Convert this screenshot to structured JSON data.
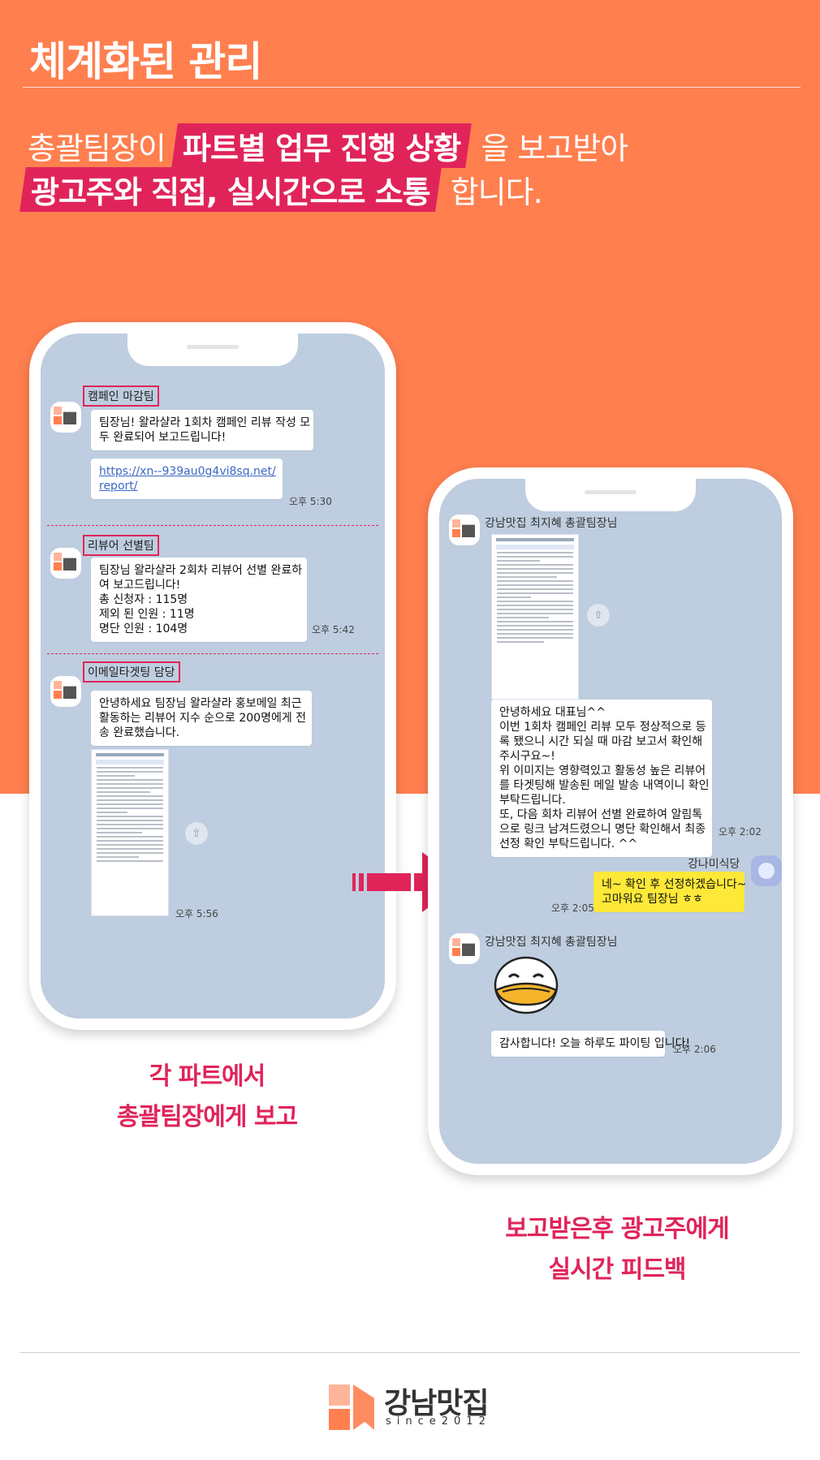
{
  "header": {
    "title": "체계화된 관리",
    "line1_pre": "총괄팀장이",
    "line1_highlight": "파트별 업무 진행 상황",
    "line1_post": "을 보고받아",
    "line2_highlight": "광고주와 직접, 실시간으로 소통",
    "line2_post": "합니다."
  },
  "phone_left": {
    "chat1": {
      "team": "캠페인 마감팀",
      "message": [
        "팀장님! 왈라샬라 1회차 캠페인 리뷰 작성 모",
        "두 완료되어 보고드립니다!"
      ],
      "link": [
        "https://xn--939au0g4vi8sq.net/",
        "report/"
      ],
      "time": "오후 5:30"
    },
    "chat2": {
      "team": "리뷰어 선별팀",
      "message": [
        "팀장님 왈라샬라 2회차 리뷰어 선별 완료하",
        "여 보고드립니다!",
        "총 신청자 : 115명",
        "제외 된 인원 : 11명",
        "명단 인원 : 104명"
      ],
      "time": "오후 5:42"
    },
    "chat3": {
      "team": "이메일타겟팅 담당",
      "message": [
        "안녕하세요 팀장님 왈라샬라 홍보메일 최근",
        "활동하는 리뷰어 지수 순으로 200명에게 전",
        "송 완료했습니다."
      ],
      "time": "오후 5:56"
    }
  },
  "phone_right": {
    "sender1": "강남맛집 최지혜 총괄팀장님",
    "message1": [
      "안녕하세요 대표님^^",
      "이번 1회차 캠페인 리뷰 모두 정상적으로 등",
      "록 됐으니 시간 되실 때 마감 보고서 확인해",
      "주시구요~!",
      "위 이미지는 영향력있고 활동성 높은 리뷰어",
      "를 타겟팅해 발송된 메일 발송 내역이니 확인",
      "부탁드립니다.",
      "또, 다음 회차 리뷰어 선별 완료하여 알림톡",
      "으로 링크 남겨드렸으니 명단 확인해서 최종",
      "선정 확인 부탁드립니다. ^^"
    ],
    "time1": "오후 2:02",
    "client_name": "강나미식당",
    "client_message": [
      "네~ 확인 후 선정하겠습니다~",
      "고마워요 팀장님 ㅎㅎ"
    ],
    "time2": "오후 2:05",
    "sender2": "강남맛집 최지혜 총괄팀장님",
    "message2": "감사합니다! 오늘 하루도 파이팅 입니다!",
    "time3": "오후 2:06"
  },
  "captions": {
    "left": [
      "각 파트에서",
      "총괄팀장에게 보고"
    ],
    "right": [
      "보고받은후 광고주에게",
      "실시간 피드백"
    ]
  },
  "logo": {
    "brand": "강남맛집",
    "since": "since2012",
    "avatar_text": "강남맛집"
  },
  "colors": {
    "orange": "#FF7F4F",
    "accent": "#E0245A",
    "chat_bg": "#BECDDF",
    "yellow_bubble": "#FEE838"
  }
}
